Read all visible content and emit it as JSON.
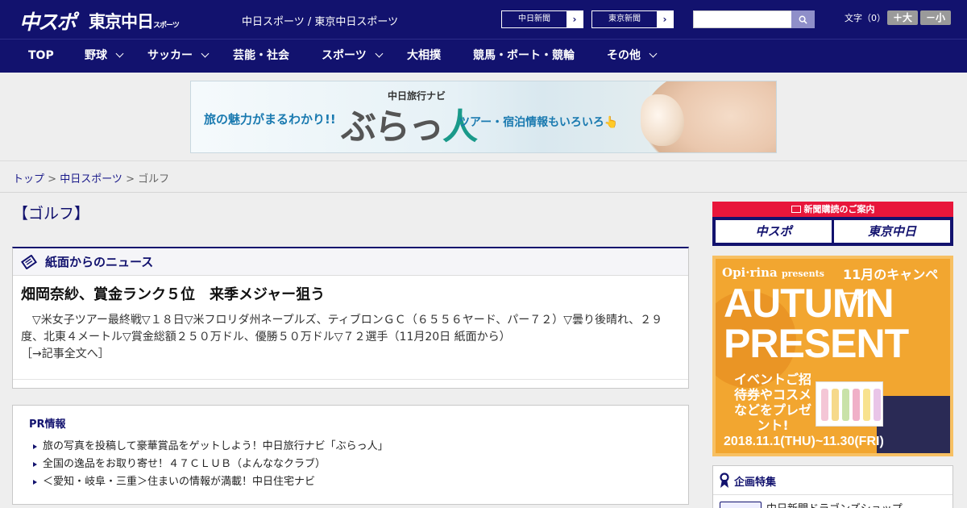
{
  "header": {
    "logo_chuspo": "中スポ",
    "logo_tokyo": "東京中日",
    "logo_tokyo_suffix": "スポーツ",
    "site_title": "中日スポーツ / 東京中日スポーツ",
    "chunichi_label": "中日新聞",
    "tokyo_label": "東京新聞",
    "search_value": "",
    "fontsize_label": "文字（0）",
    "fontsize_up": "＋大",
    "fontsize_down": "－小"
  },
  "nav": {
    "items": [
      {
        "label": "TOP"
      },
      {
        "label": "野球"
      },
      {
        "label": "サッカー"
      },
      {
        "label": "芸能・社会"
      },
      {
        "label": "スポーツ"
      },
      {
        "label": "大相撲"
      },
      {
        "label": "競馬・ボート・競輪"
      },
      {
        "label": "その他"
      }
    ]
  },
  "banner": {
    "tagline": "旅の魅力がまるわかり!!",
    "brand_small": "中日旅行ナビ",
    "brand_main_a": "ぶらっ",
    "brand_main_b": "人",
    "subline": "ツアー・宿泊情報もいろいろ👆"
  },
  "breadcrumb": {
    "home": "トップ",
    "section": "中日スポーツ",
    "current": "ゴルフ",
    "sep": " > "
  },
  "main": {
    "category": "【ゴルフ】",
    "news_section": "紙面からのニュース",
    "article_title": "畑岡奈紗、賞金ランク５位　来季メジャー狙う",
    "article_body": "　▽米女子ツアー最終戦▽１８日▽米フロリダ州ネープルズ、ティブロンＧＣ（６５５６ヤード、パー７２）▽曇り後晴れ、２９度、北東４メートル▽賞金総額２５０万ドル、優勝５０万ドル▽７２選手（11月20日 紙面から）",
    "read_more": "［→記事全文へ］",
    "pr_title": "PR情報",
    "pr_items": [
      "旅の写真を投稿して豪華賞品をゲットしよう！中日旅行ナビ「ぶらっ人」",
      "全国の逸品をお取り寄せ！４７ＣＬＵＢ（よんななクラブ）",
      "＜愛知・岐阜・三重＞住まいの情報が満載！中日住宅ナビ"
    ]
  },
  "sidebar": {
    "subscribe_title": "新聞購読のご案内",
    "subscribe_chuspo": "中スポ",
    "subscribe_tokyo": "東京中日",
    "ad_brand": "Opi·rina",
    "ad_presents": "presents",
    "ad_month": "11月のキャンペーン",
    "ad_autumn": "AUTUMN",
    "ad_present": "PRESENT",
    "ad_event": "イベントご招待券やコスメなどをプレゼント!",
    "ad_date": "2018.11.1(THU)~11.30(FRI)",
    "feature_title": "企画特集",
    "feature_item": "中日新聞ドラゴンズショップ"
  },
  "colors": {
    "brand_navy": "#12126e",
    "subscribe_red": "#e8163b",
    "ad_orange": "#f2a630"
  }
}
